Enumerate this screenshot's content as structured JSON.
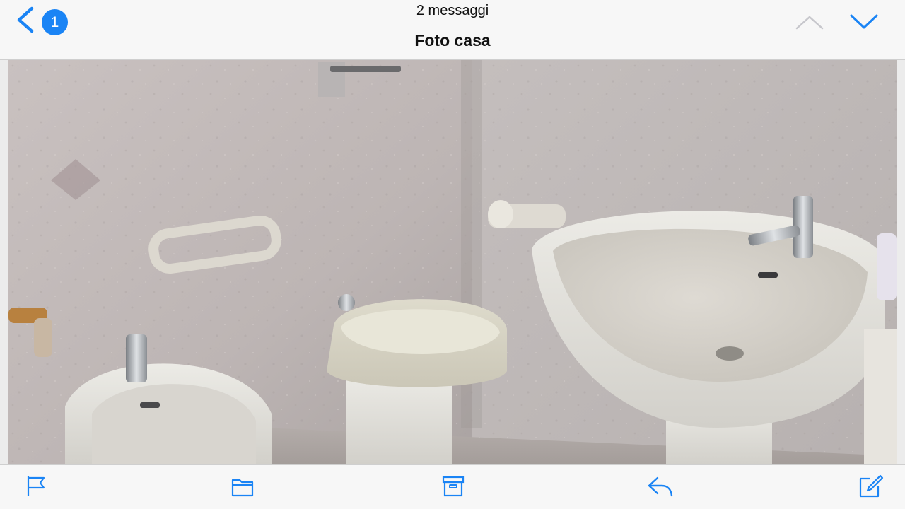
{
  "header": {
    "message_count": "2 messaggi",
    "subject": "Foto casa",
    "unread_badge": "1",
    "back_icon": "chevron-left-icon",
    "prev_icon": "chevron-up-icon",
    "next_icon": "chevron-down-icon",
    "accent_color": "#1a84f5",
    "disabled_color": "#c7c7cc"
  },
  "attachment": {
    "alt": "Foto del bagno: bidet, WC e lavabo"
  },
  "toolbar": {
    "icons": [
      "flag-icon",
      "folder-icon",
      "archive-icon",
      "reply-icon",
      "compose-icon"
    ],
    "accent_color": "#1a84f5"
  }
}
